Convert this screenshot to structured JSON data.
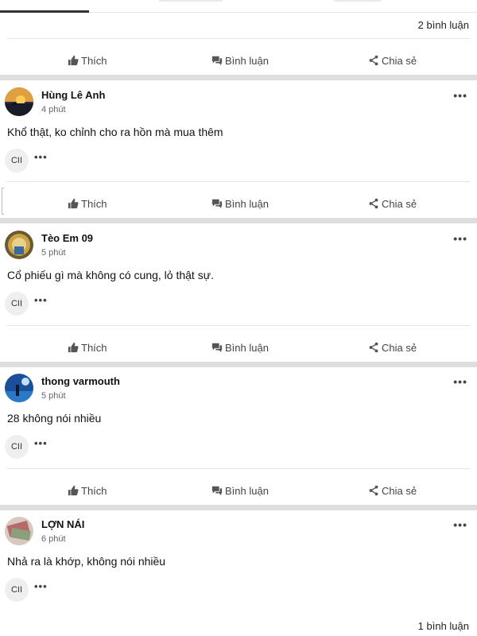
{
  "top_comment_count": "2 bình luận",
  "bottom_comment_count": "1 bình luận",
  "actions": {
    "like": "Thích",
    "comment": "Bình luận",
    "share": "Chia sẻ"
  },
  "more": "•••",
  "posts": [
    {
      "author": "Hùng Lê Anh",
      "time": "4 phút",
      "content": "Khổ thật, ko chỉnh cho ra hồn mà mua thêm",
      "tag": "CII",
      "avatar": "sunset-avatar"
    },
    {
      "author": "Tèo Em 09",
      "time": "5 phút",
      "content": "Cổ phiếu gì mà không có cung, lỏ thật sự.",
      "tag": "CII",
      "avatar": "temple-avatar"
    },
    {
      "author": "thong varmouth",
      "time": "5 phút",
      "content": "28 không nói nhiều",
      "tag": "CII",
      "avatar": "blue-scene-avatar"
    },
    {
      "author": "LỢN NÁI",
      "time": "6 phút",
      "content": "Nhả ra là khớp, không nói nhiều",
      "tag": "CII",
      "avatar": "money-avatar"
    }
  ],
  "colors": {
    "separator": "#dedede",
    "divider": "#e4e4e4",
    "tag_bg": "#efefef"
  }
}
